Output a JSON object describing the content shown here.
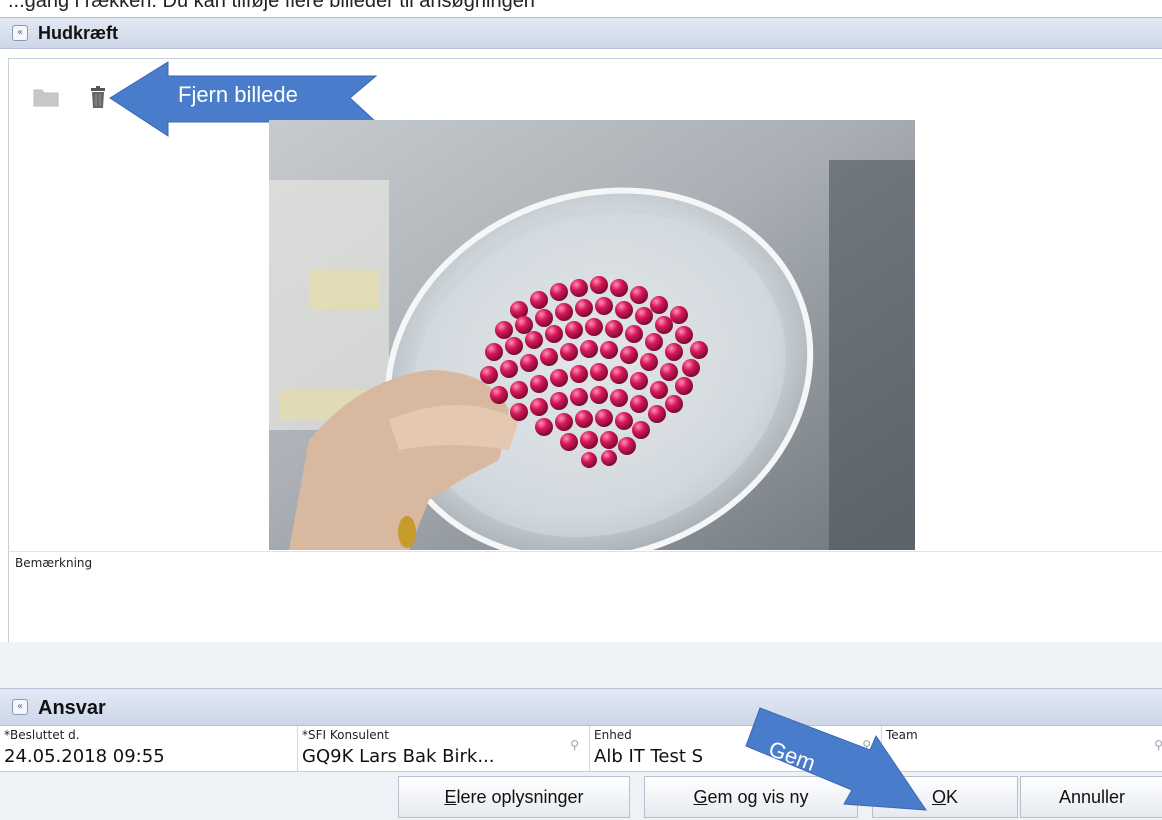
{
  "caption": "...gang i rækken. Du kan tilføje flere billeder til ansøgningen",
  "section_skin": {
    "title": "Hudkræft",
    "collapse_glyph": "«"
  },
  "image_panel": {
    "toolbar": {
      "folder_icon": "folder-icon",
      "delete_icon": "trash-icon"
    },
    "callout_remove": "Fjern billede"
  },
  "remark": {
    "label": "Bemærkning",
    "value": ""
  },
  "section_ansvar": {
    "title": "Ansvar"
  },
  "fields": [
    {
      "label": "*Besluttet d.",
      "value": "24.05.2018 09:55"
    },
    {
      "label": "*SFI Konsulent",
      "value": "GQ9K Lars Bak Birk..."
    },
    {
      "label": "Enhed",
      "value": "Alb IT Test S"
    },
    {
      "label": "Team",
      "value": ""
    }
  ],
  "callout_save": "Gem",
  "buttons": {
    "more_info": {
      "underlined": "E",
      "rest": "lere oplysninger"
    },
    "save_show_new": {
      "underlined": "G",
      "rest": "em og vis ny"
    },
    "ok": {
      "underlined": "O",
      "rest": "K"
    },
    "cancel": "Annuller"
  },
  "colors": {
    "callout_blue": "#4a7ccc",
    "header_bg": "#d6dfee",
    "beads": "#d8195a"
  }
}
